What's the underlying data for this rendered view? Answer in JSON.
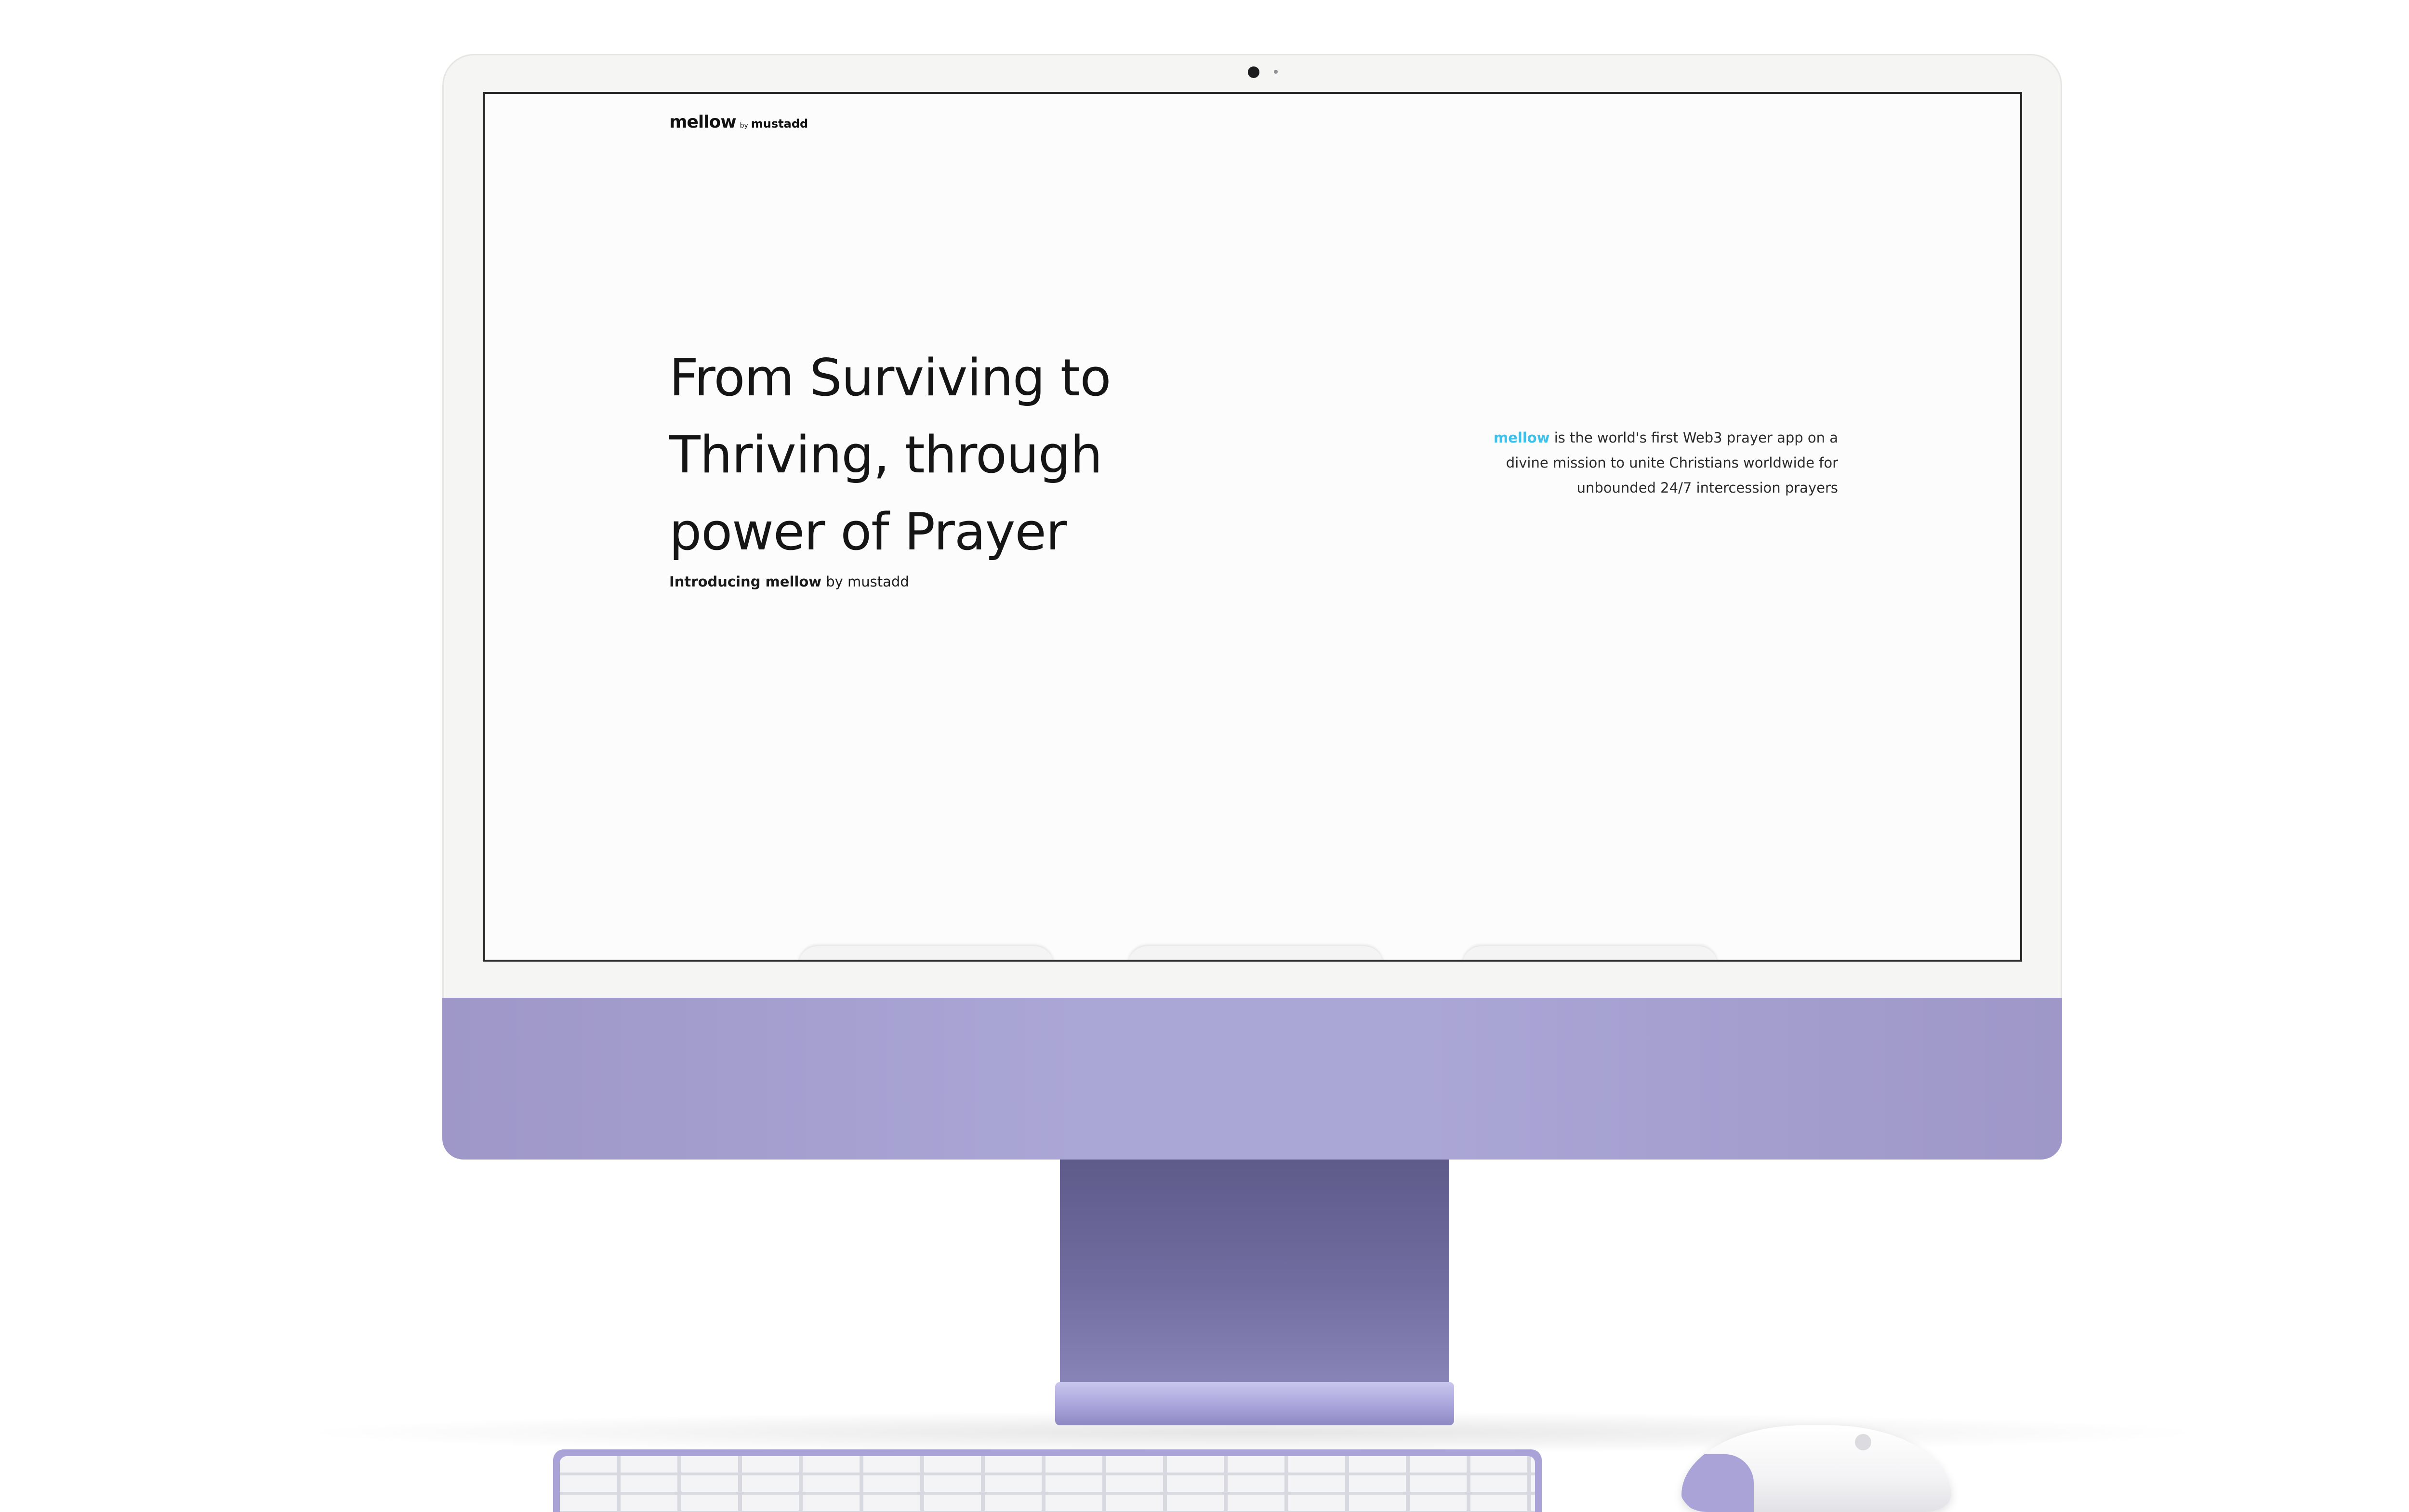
{
  "screen": {
    "logo": {
      "name": "mellow",
      "by": "by",
      "company": "mustadd"
    },
    "hero": {
      "line1": "From Surviving to",
      "line2": "Thriving, through",
      "line3": "power of Prayer"
    },
    "intro": {
      "strong": "Introducing mellow",
      "rest": " by mustadd"
    },
    "description": {
      "brand": "mellow",
      "line1_rest": " is the world's first Web3 prayer app on a",
      "line2": "divine mission to unite Christians worldwide for",
      "line3": "unbounded 24/7 intercession prayers"
    },
    "cards_peeking": 3
  },
  "colors": {
    "accent": "#3cc1ec",
    "device_purple": "#aaa6d6",
    "stand_purple": "#716da0",
    "text": "#151515"
  }
}
